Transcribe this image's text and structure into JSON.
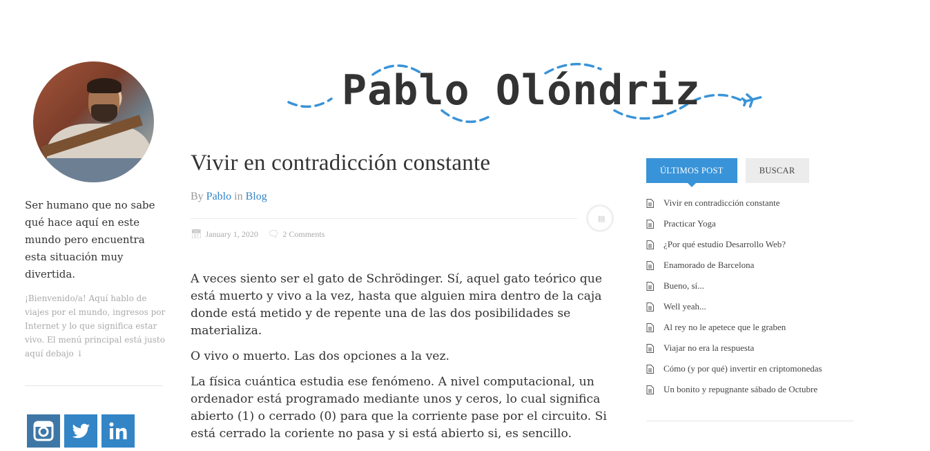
{
  "site": {
    "logo_text": "Pablo Olóndriz",
    "accent": "#3993d8"
  },
  "sidebar": {
    "tagline": "Ser humano que no sabe qué hace aquí en este mundo pero encuentra esta situación muy divertida.",
    "welcome": "¡Bienvenido/a! Aquí hablo de viajes por el mundo, ingresos por Internet y lo que significa estar vivo. El menú principal está justo aquí debajo ↓",
    "social": [
      {
        "name": "instagram-icon"
      },
      {
        "name": "twitter-icon"
      },
      {
        "name": "linkedin-icon"
      }
    ]
  },
  "post": {
    "title": "Vivir en contradicción constante",
    "by_prefix": "By",
    "author": "Pablo",
    "in_word": "in",
    "category": "Blog",
    "date": "January 1, 2020",
    "comments": "2 Comments",
    "paragraphs": [
      "A veces siento ser el gato de Schrödinger. Sí, aquel gato teórico que está muerto y vivo a la vez, hasta que alguien mira dentro de la caja donde está metido y de repente una de las dos posibilidades se materializa.",
      "O vivo o muerto. Las dos opciones a la vez.",
      "La física cuántica estudia ese fenómeno. A nivel computacional, un ordenador está programado mediante unos y ceros, lo cual significa abierto (1) o cerrado (0) para que la corriente pase por el circuito. Si está cerrado la coriente no pasa y si está abierto si, es sencillo."
    ]
  },
  "widget": {
    "tabs": [
      "ÚLTIMOS POST",
      "BUSCAR"
    ],
    "recent_posts": [
      "Vivir en contradicción constante",
      "Practicar Yoga",
      "¿Por qué estudio Desarrollo Web?",
      "Enamorado de Barcelona",
      "Bueno, sí...",
      "Well yeah...",
      "Al rey no le apetece que le graben",
      "Viajar no era la respuesta",
      "Cómo (y por qué) invertir en criptomonedas",
      "Un bonito y repugnante sábado de Octubre"
    ]
  }
}
